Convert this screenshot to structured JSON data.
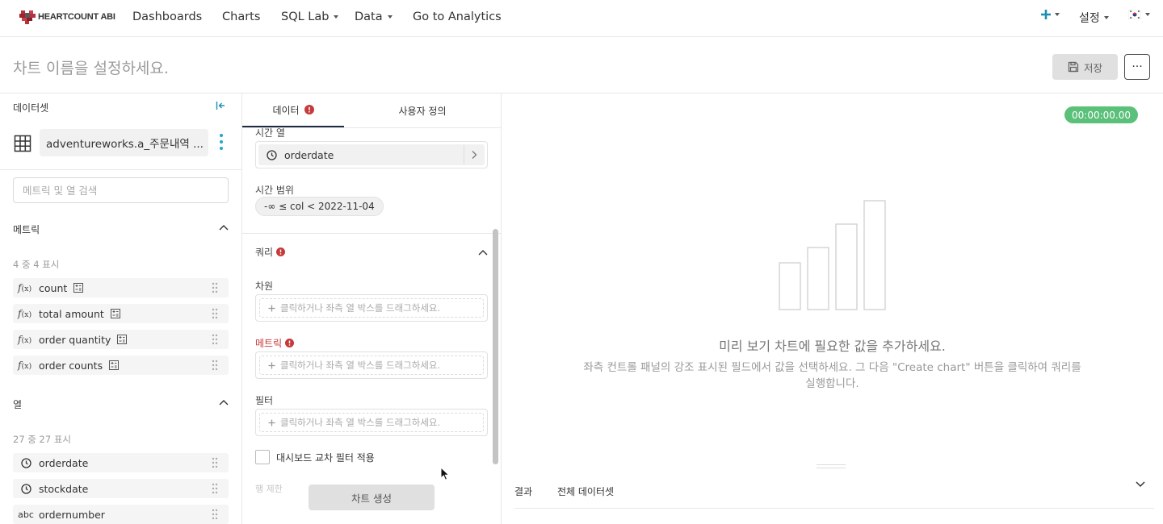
{
  "nav": {
    "logo_text": "HEARTCOUNT ABI",
    "items": [
      "Dashboards",
      "Charts",
      "SQL Lab",
      "Data",
      "Go to Analytics"
    ],
    "settings_label": "설정",
    "colors": {
      "plus": "#1c8fb6",
      "accent": "#20a7c9"
    }
  },
  "title": {
    "chart_name_placeholder": "차트 이름을 설정하세요.",
    "save_label": "저장",
    "more_label": "···"
  },
  "dataset": {
    "heading": "데이터셋",
    "name": "adventureworks.a_주문내역 ...",
    "search_placeholder": "메트릭 및 열 검색",
    "metrics": {
      "heading": "메트릭",
      "count_text": "4 중 4 표시",
      "items": [
        "count",
        "total amount",
        "order quantity",
        "order counts"
      ]
    },
    "columns": {
      "heading": "열",
      "count_text": "27 중 27 표시",
      "items": [
        {
          "type": "time",
          "name": "orderdate"
        },
        {
          "type": "time",
          "name": "stockdate"
        },
        {
          "type": "abc",
          "name": "ordernumber"
        }
      ]
    }
  },
  "config": {
    "tabs": [
      "데이터",
      "사용자 정의"
    ],
    "time_column_label": "시간 열",
    "time_column_value": "orderdate",
    "time_range_label": "시간 범위",
    "time_range_value": "-∞ ≤ col < 2022-11-04",
    "query_label": "쿼리",
    "dimension_label": "차원",
    "metric_label": "메트릭",
    "filter_label": "필터",
    "drop_placeholder": "클릭하거나 좌측 열 박스를 드래그하세요.",
    "cross_filter_label": "대시보드 교차 필터 적용",
    "faded_label": "행 제한",
    "create_chart_label": "차트 생성"
  },
  "preview": {
    "timer": "00:00:00.00",
    "title": "미리 보기 차트에 필요한 값을 추가하세요.",
    "subtitle": "좌측 컨트롤 패널의 강조 표시된 필드에서 값을 선택하세요. 그 다음 \"Create chart\" 버튼을 클릭하여 쿼리를 실행합니다.",
    "result_tabs": [
      "결과",
      "전체 데이터셋"
    ]
  }
}
